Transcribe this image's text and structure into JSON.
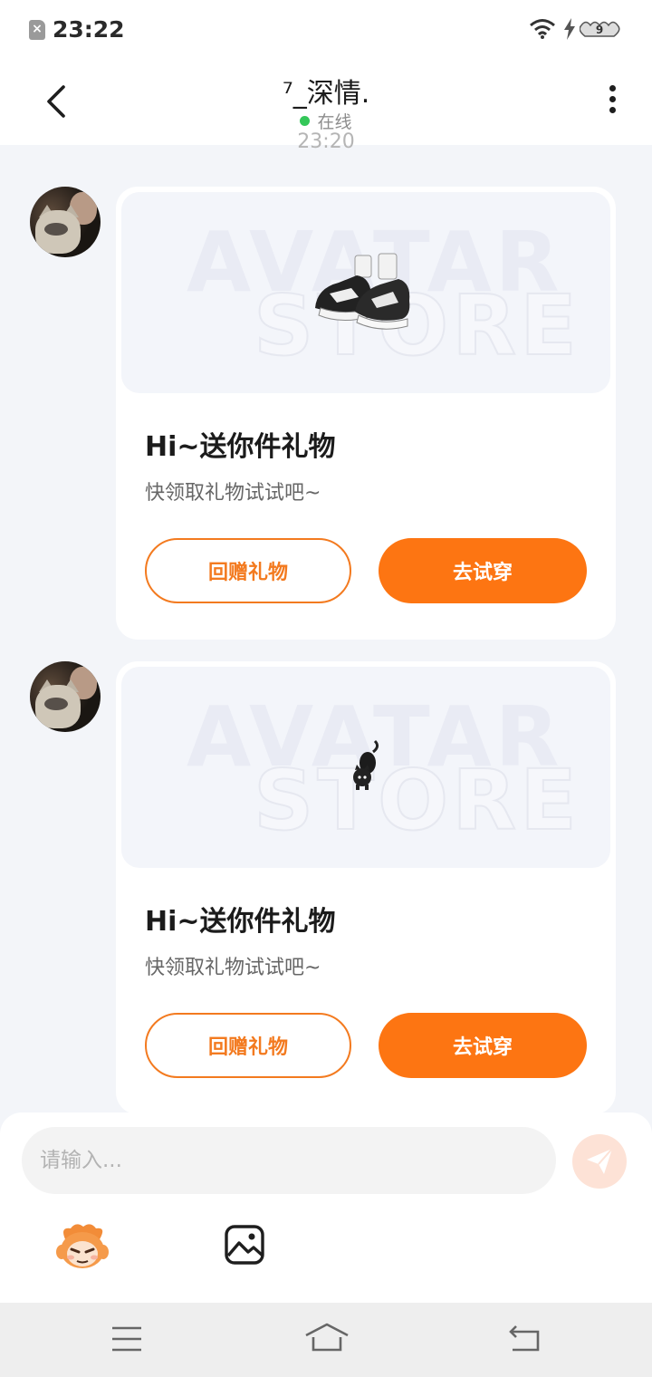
{
  "status_bar": {
    "time": "23:22",
    "battery_level": "9"
  },
  "header": {
    "title": "⁷_深情.",
    "status": "在线"
  },
  "messages": [
    {
      "time": "23:20"
    },
    {
      "watermark_line1": "AVATAR",
      "watermark_line2": "STORE",
      "gift": "sneakers",
      "title": "Hi~送你件礼物",
      "subtitle": "快领取礼物试试吧~",
      "return_gift_label": "回赠礼物",
      "try_on_label": "去试穿"
    },
    {
      "watermark_line1": "AVATAR",
      "watermark_line2": "STORE",
      "gift": "black-cat-figure",
      "title": "Hi~送你件礼物",
      "subtitle": "快领取礼物试试吧~",
      "return_gift_label": "回赠礼物",
      "try_on_label": "去试穿"
    }
  ],
  "composer": {
    "placeholder": "请输入..."
  },
  "icons": [
    "back-icon",
    "more-icon",
    "send-icon",
    "mascot-icon",
    "image-icon",
    "menu-icon",
    "home-icon",
    "back-nav-icon"
  ],
  "colors": {
    "accent": "#fd7512",
    "online": "#34c759",
    "background": "#f3f5f9"
  }
}
